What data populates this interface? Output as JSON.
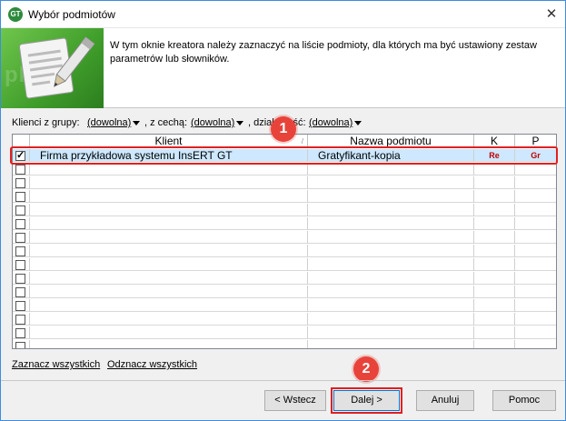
{
  "window": {
    "title": "Wybór podmiotów",
    "app_icon_text": "GT",
    "close_glyph": "✕"
  },
  "banner": {
    "watermark": "pl   ert",
    "description": "W tym oknie kreatora należy zaznaczyć na liście podmioty, dla których ma być ustawiony zestaw parametrów lub słowników."
  },
  "filters": {
    "group_label": "Klienci z grupy:",
    "group_value": "(dowolna)",
    "feature_label": ", z cechą:",
    "feature_value": "(dowolna)",
    "activity_label": ", działalność:",
    "activity_value": "(dowolna)"
  },
  "grid": {
    "columns": [
      "Klient",
      "Nazwa podmiotu",
      "K",
      "P"
    ],
    "rows": [
      {
        "checked": true,
        "client": "Firma przykładowa systemu InsERT GT",
        "entity": "Gratyfikant-kopia",
        "k": "Re",
        "p": "Gr"
      }
    ],
    "empty_rows": 14
  },
  "links": {
    "select_all": "Zaznacz wszystkich",
    "deselect_all": "Odznacz wszystkich"
  },
  "buttons": {
    "back": "< Wstecz",
    "next": "Dalej >",
    "cancel": "Anuluj",
    "help": "Pomoc"
  },
  "markers": {
    "step1": "1",
    "step2": "2"
  },
  "colors": {
    "accent": "#e02020",
    "selection": "#cde8ff",
    "badge": "#c00000",
    "banner_green": "#3f9d2a"
  }
}
